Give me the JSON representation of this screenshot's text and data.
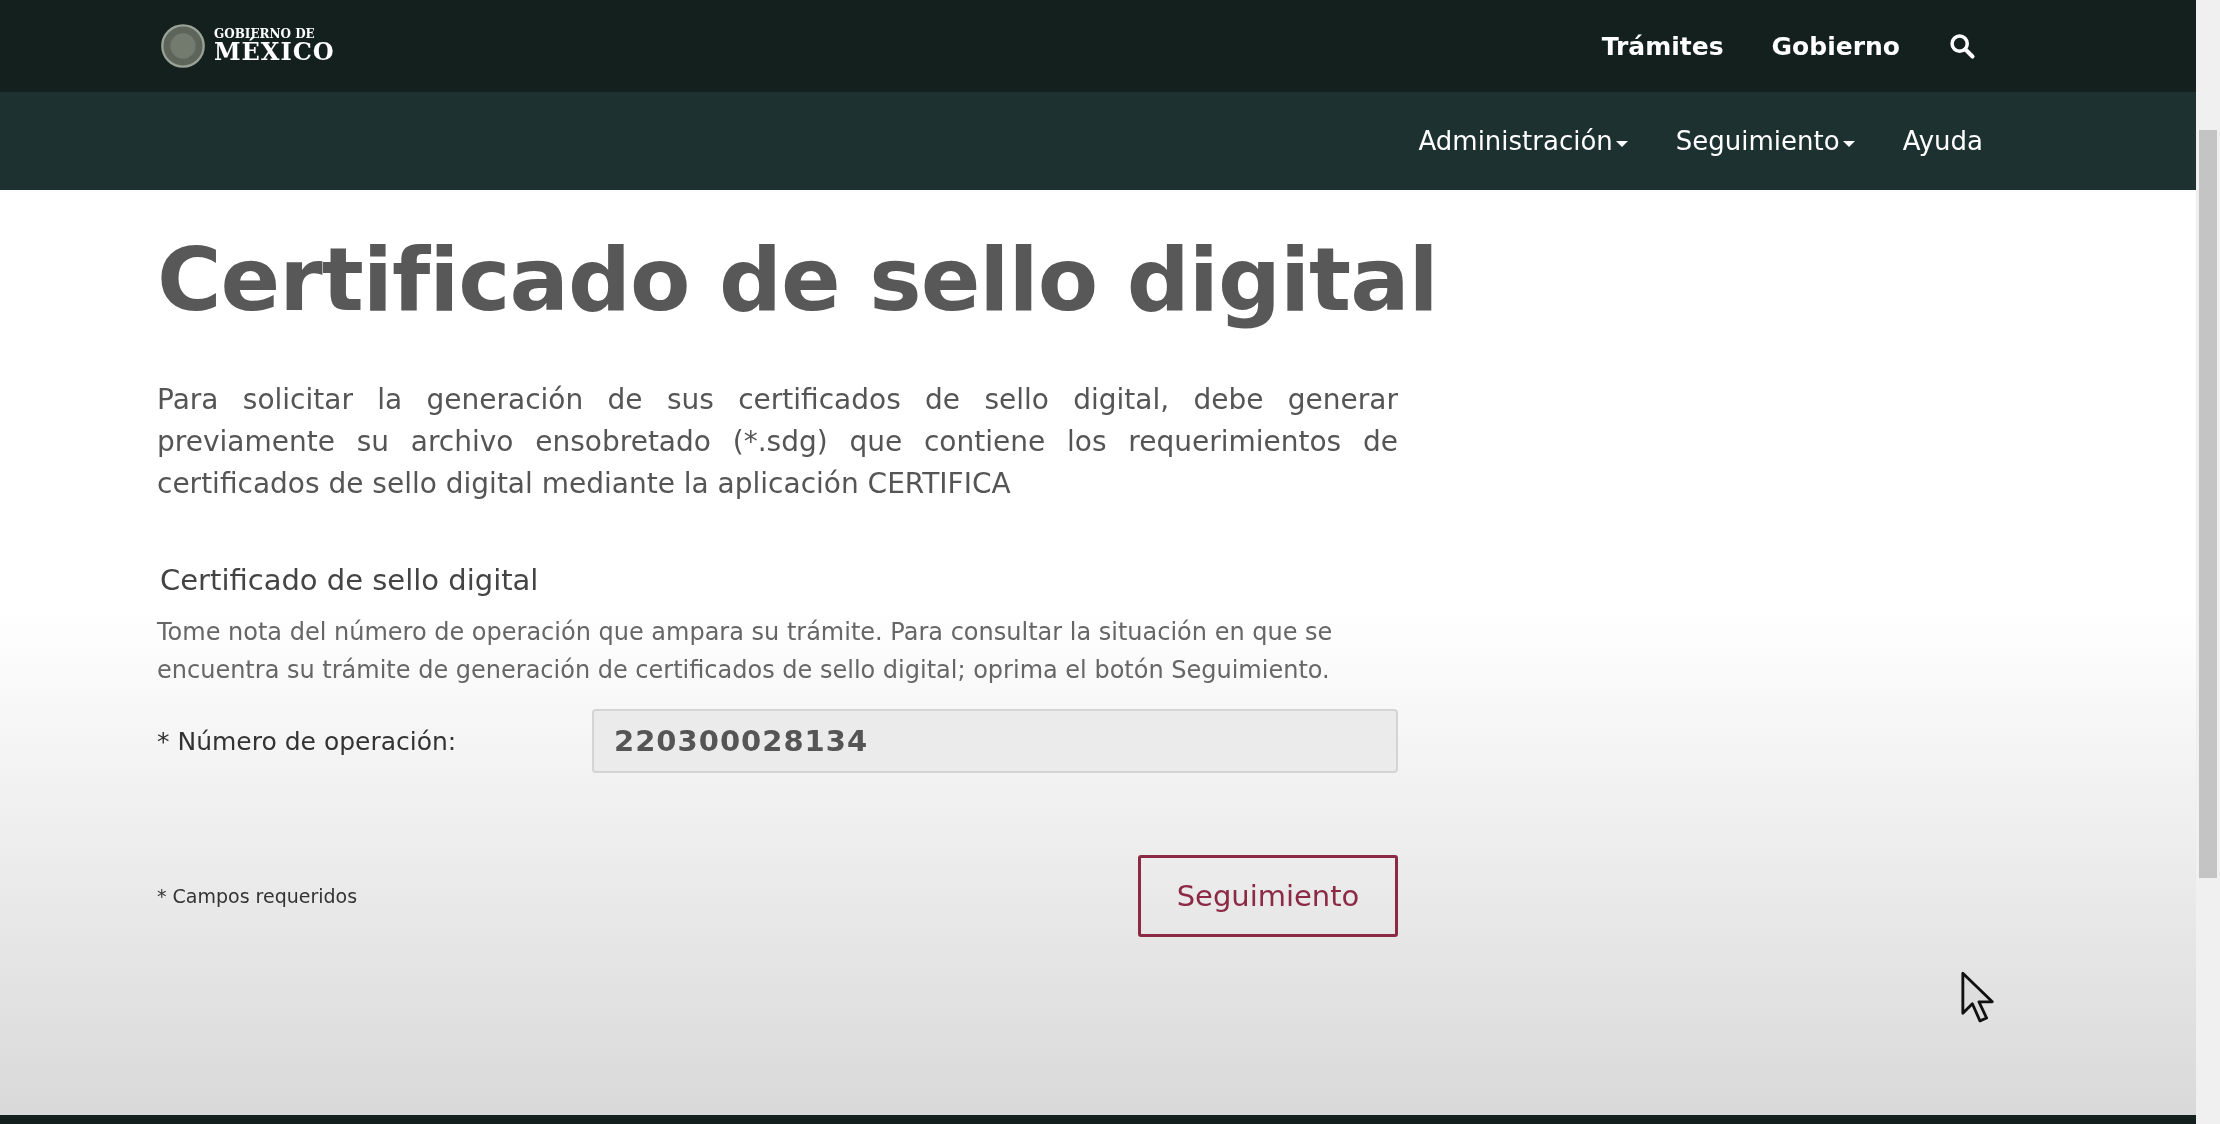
{
  "header": {
    "logo": {
      "line1": "GOBIERNO DE",
      "line2": "MÉXICO"
    },
    "links": [
      "Trámites",
      "Gobierno"
    ]
  },
  "subnav": [
    {
      "label": "Administración",
      "has_menu": true
    },
    {
      "label": "Seguimiento",
      "has_menu": true
    },
    {
      "label": "Ayuda",
      "has_menu": false
    }
  ],
  "page": {
    "title": "Certificado de sello digital",
    "intro": "Para solicitar la generación de sus certificados de sello digital, debe generar previamente su archivo ensobretado (*.sdg) que contiene los requerimientos de certificados de sello digital mediante la aplicación CERTIFICA"
  },
  "form": {
    "heading": "Certificado de sello digital",
    "note": "Tome nota del número de operación que ampara su trámite. Para consultar la situación en que se encuentra su trámite de generación de certificados de sello digital; oprima el botón Seguimiento.",
    "field": {
      "label": "* Número de operación:",
      "value": "220300028134",
      "disabled": true
    },
    "required_note": "* Campos requeridos",
    "button": "Seguimiento"
  }
}
